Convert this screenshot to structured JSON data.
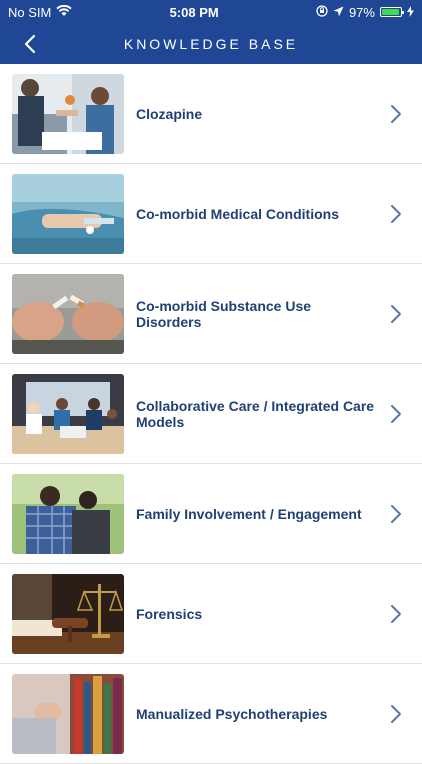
{
  "status": {
    "carrier": "No SIM",
    "time": "5:08 PM",
    "battery": "97%",
    "battery_level": 0.97
  },
  "nav": {
    "title": "KNOWLEDGE BASE",
    "back_icon": "chevron-left-icon"
  },
  "items": [
    {
      "label": "Clozapine",
      "image": "clinician-consultation-photo"
    },
    {
      "label": "Co-morbid Medical Conditions",
      "image": "hospital-patient-photo"
    },
    {
      "label": "Co-morbid Substance Use Disorders",
      "image": "broken-cigarette-photo"
    },
    {
      "label": "Collaborative Care / Integrated Care Models",
      "image": "team-meeting-photo"
    },
    {
      "label": "Family Involvement / Engagement",
      "image": "family-embrace-photo"
    },
    {
      "label": "Forensics",
      "image": "gavel-scales-photo"
    },
    {
      "label": "Manualized Psychotherapies",
      "image": "bookshelf-photo"
    }
  ],
  "colors": {
    "header": "#1f4795",
    "label": "#1f4173",
    "chevron": "#5b7aa8"
  }
}
